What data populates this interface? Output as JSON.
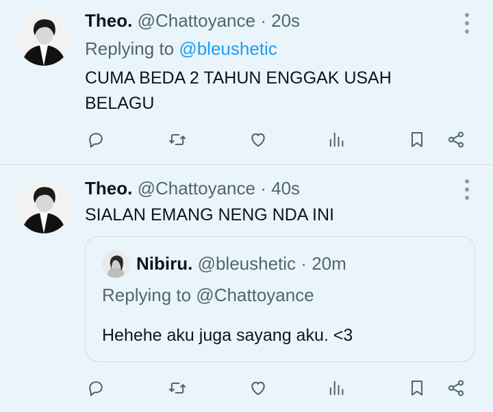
{
  "tweets": [
    {
      "name": "Theo.",
      "handle": "@Chattoyance",
      "separator": "·",
      "time": "20s",
      "replying_prefix": "Replying to",
      "replying_to": "@bleushetic",
      "text": "CUMA BEDA 2 TAHUN ENGGAK USAH BELAGU"
    },
    {
      "name": "Theo.",
      "handle": "@Chattoyance",
      "separator": "·",
      "time": "40s",
      "text": "SIALAN EMANG NENG NDA INI",
      "quote": {
        "name": "Nibiru.",
        "handle": "@bleushetic",
        "separator": "·",
        "time": "20m",
        "replying": "Replying to @Chattoyance",
        "text": "Hehehe aku juga sayang aku. <3"
      }
    }
  ],
  "icons": {
    "reply": "reply-icon",
    "retweet": "retweet-icon",
    "like": "heart-icon",
    "views": "views-icon",
    "bookmark": "bookmark-icon",
    "share": "share-icon",
    "more": "more-vertical-icon"
  },
  "colors": {
    "background": "#eaf5fb",
    "accent": "#1d9bf0",
    "secondary_text": "#536471",
    "primary_text": "#0f1419",
    "icon": "#536471"
  }
}
